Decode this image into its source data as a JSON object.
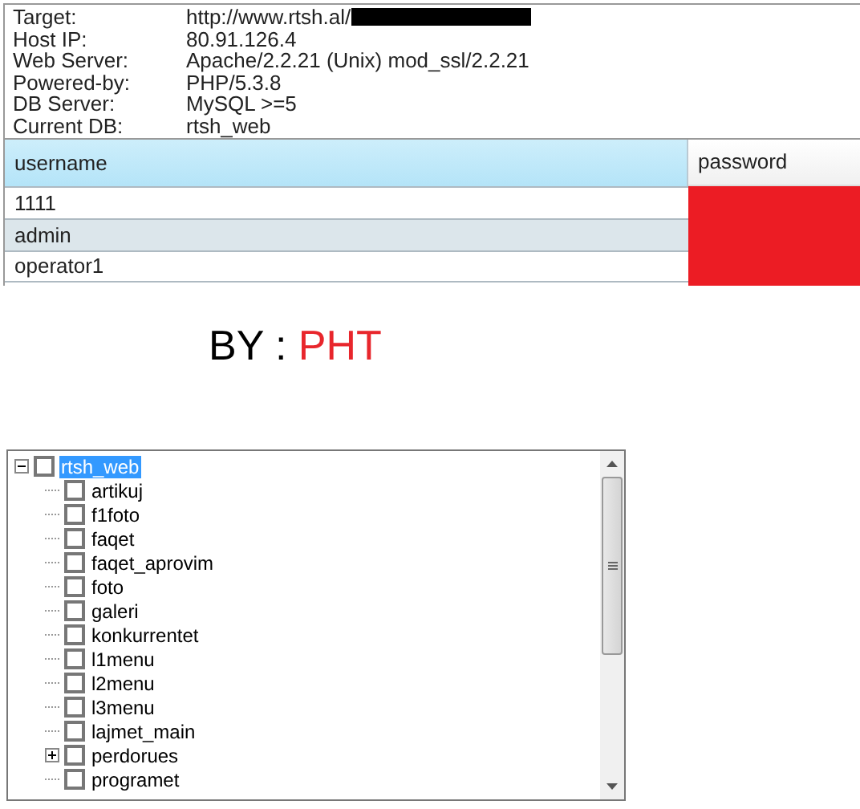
{
  "info": [
    {
      "label": "Target:",
      "value": "http://www.rtsh.al/",
      "redacted": true
    },
    {
      "label": "Host IP:",
      "value": "80.91.126.4"
    },
    {
      "label": "Web Server:",
      "value": "Apache/2.2.21 (Unix) mod_ssl/2.2.21"
    },
    {
      "label": "Powered-by:",
      "value": "PHP/5.3.8"
    },
    {
      "label": "DB Server:",
      "value": "MySQL >=5"
    },
    {
      "label": "Current DB:",
      "value": "rtsh_web"
    }
  ],
  "table": {
    "columns": [
      "username",
      "password"
    ],
    "rows": [
      {
        "username": "1111",
        "selected": false
      },
      {
        "username": "admin",
        "selected": true
      },
      {
        "username": "operator1",
        "selected": false
      }
    ]
  },
  "banner": {
    "prefix": "BY : ",
    "name": "PHT"
  },
  "tree": {
    "label": "rtsh_web",
    "selected": true,
    "expanded": true,
    "checked": false,
    "children": [
      {
        "label": "artikuj",
        "kind": "leaf",
        "checked": false,
        "selected": false
      },
      {
        "label": "f1foto",
        "kind": "leaf",
        "checked": false,
        "selected": false
      },
      {
        "label": "faqet",
        "kind": "leaf",
        "checked": false,
        "selected": false
      },
      {
        "label": "faqet_aprovim",
        "kind": "leaf",
        "checked": false,
        "selected": false
      },
      {
        "label": "foto",
        "kind": "leaf",
        "checked": false,
        "selected": false
      },
      {
        "label": "galeri",
        "kind": "leaf",
        "checked": false,
        "selected": false
      },
      {
        "label": "konkurrentet",
        "kind": "leaf",
        "checked": false,
        "selected": false
      },
      {
        "label": "l1menu",
        "kind": "leaf",
        "checked": false,
        "selected": false
      },
      {
        "label": "l2menu",
        "kind": "leaf",
        "checked": false,
        "selected": false
      },
      {
        "label": "l3menu",
        "kind": "leaf",
        "checked": false,
        "selected": false
      },
      {
        "label": "lajmet_main",
        "kind": "leaf",
        "checked": false,
        "selected": false
      },
      {
        "label": "perdorues",
        "kind": "branch",
        "expanded": false,
        "checked": false,
        "selected": false
      },
      {
        "label": "programet",
        "kind": "leaf",
        "checked": false,
        "selected": false
      }
    ]
  }
}
